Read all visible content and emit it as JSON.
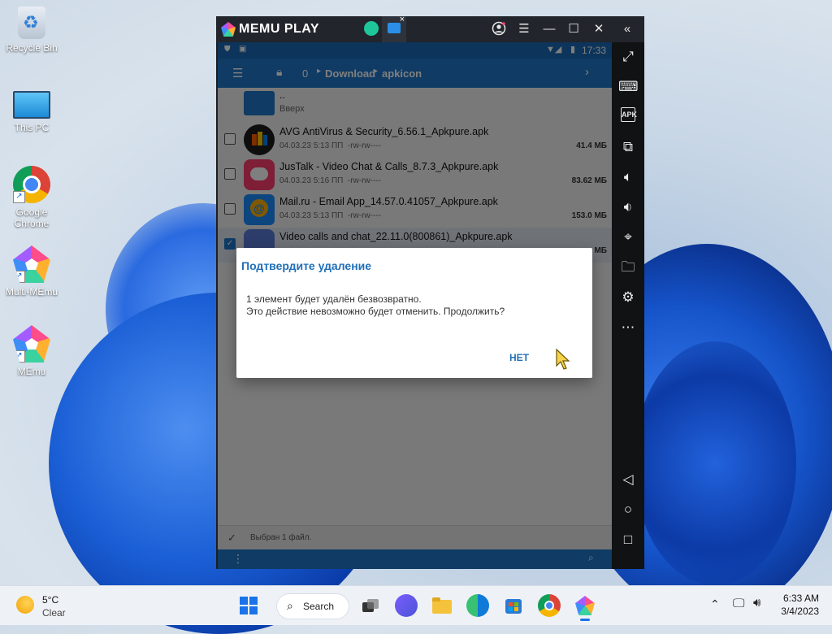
{
  "desktop": {
    "icons": [
      {
        "label": "Recycle Bin"
      },
      {
        "label": "This PC"
      },
      {
        "label": "Google Chrome"
      },
      {
        "label": "Multi-MEmu"
      },
      {
        "label": "MEmu"
      }
    ]
  },
  "emulator": {
    "brand": "MEMU PLAY",
    "titlebar_icons": [
      "user-icon",
      "menu-icon",
      "minimize-icon",
      "maximize-icon",
      "close-icon",
      "collapse-icon"
    ],
    "sidebar_icons": [
      "fullscreen-icon",
      "keyboard-icon",
      "apk-icon",
      "multi-window-icon",
      "volume-up-icon",
      "volume-down-icon",
      "location-icon",
      "folder-icon",
      "settings-icon",
      "more-icon",
      "back-icon",
      "home-icon",
      "recents-icon"
    ],
    "sidebar_apk_label": "APK"
  },
  "android": {
    "status": {
      "time": "17:33"
    },
    "toolbar": {
      "count": "0",
      "path": [
        "Download",
        "apkicon"
      ]
    },
    "up_entry": {
      "name": "..",
      "label": "Вверх"
    },
    "files": [
      {
        "name": "AVG AntiVirus & Security_6.56.1_Apkpure.apk",
        "date": "04.03.23 5:13 ПП",
        "perm": "-rw-rw----",
        "size": "41.4 МБ",
        "color": "#1d1d1d"
      },
      {
        "name": "JusTalk - Video Chat & Calls_8.7.3_Apkpure.apk",
        "date": "04.03.23 5:16 ПП",
        "perm": "-rw-rw----",
        "size": "83.62 МБ",
        "color": "#ff3d6e"
      },
      {
        "name": "Mail.ru - Email App_14.57.0.41057_Apkpure.apk",
        "date": "04.03.23 5:13 ПП",
        "perm": "-rw-rw----",
        "size": "153.0 МБ",
        "color": "#1a8cff"
      },
      {
        "name": "Video calls and chat_22.11.0(800861)_Apkpure.apk",
        "date": "",
        "perm": "",
        "size": "МБ",
        "color": "#5b7bd6"
      }
    ],
    "selection_text": "Выбран 1 файл."
  },
  "dialog": {
    "title": "Подтвердите удаление",
    "line1": "1 элемент будет удалён безвозвратно.",
    "line2": "Это действие невозможно будет отменить. Продолжить?",
    "no_button": "НЕТ"
  },
  "taskbar": {
    "weather_temp": "5°C",
    "weather_desc": "Clear",
    "search_label": "Search",
    "time": "6:33 AM",
    "date": "3/4/2023"
  }
}
